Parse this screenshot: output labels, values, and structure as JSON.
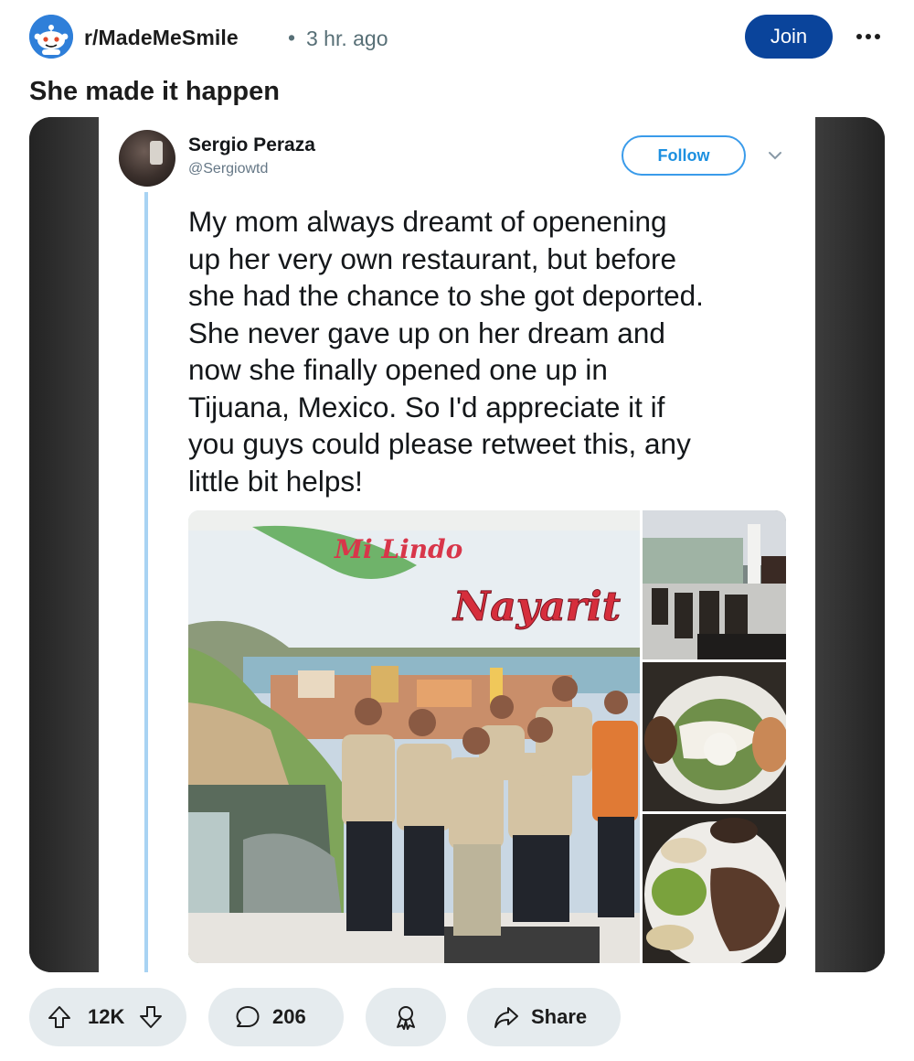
{
  "header": {
    "subreddit": "r/MadeMeSmile",
    "separator": "•",
    "time": "3 hr. ago",
    "join_label": "Join",
    "avatar_icon": "reddit-snoo-icon",
    "more_icon": "overflow-menu-icon"
  },
  "post": {
    "title": "She made it happen"
  },
  "tweet": {
    "name": "Sergio Peraza",
    "handle": "@Sergiowtd",
    "follow_label": "Follow",
    "text": "My mom always dreamt of openening\nup her very own restaurant, but before\nshe had the chance to she got deported.\nShe never gave up on her dream and\nnow she finally opened one up in\nTijuana, Mexico. So I'd appreciate it if\nyou guys could please retweet this, any\nlittle bit helps!",
    "mural_text_1": "Mi Lindo",
    "mural_text_2": "Nayarit"
  },
  "actions": {
    "upvotes": "12K",
    "comments": "206",
    "share_label": "Share"
  },
  "colors": {
    "join_bg": "#0a449b",
    "pill_bg": "#e5ebee",
    "follow_blue": "#1d90e0",
    "thread_line": "#a8d3f3"
  }
}
